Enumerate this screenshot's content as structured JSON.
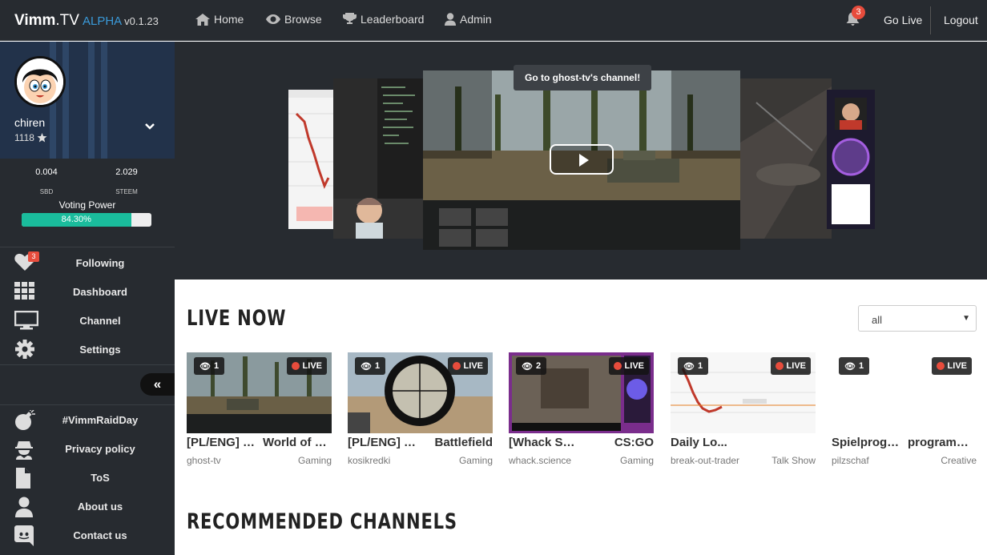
{
  "app": {
    "name": "Vimm",
    "suffix": ".TV",
    "alpha": "ALPHA",
    "version": "v0.1.23"
  },
  "nav": {
    "home": "Home",
    "browse": "Browse",
    "leaderboard": "Leaderboard",
    "admin": "Admin"
  },
  "header": {
    "notifications": "3",
    "go_live": "Go Live",
    "logout": "Logout"
  },
  "profile": {
    "username": "chiren",
    "reputation": "1118"
  },
  "wallet": {
    "sbd": "0.004",
    "sbd_label": "SBD",
    "steem": "2.029",
    "steem_label": "STEEM"
  },
  "voting": {
    "label": "Voting Power",
    "text": "84.30%",
    "fraction": 0.843
  },
  "menu": {
    "following": "Following",
    "following_badge": "3",
    "dashboard": "Dashboard",
    "channel": "Channel",
    "settings": "Settings",
    "raid": "#VimmRaidDay",
    "privacy": "Privacy policy",
    "tos": "ToS",
    "about": "About us",
    "contact": "Contact us"
  },
  "collapse_label": "«",
  "hero": {
    "tooltip": "Go to ghost-tv's channel!"
  },
  "live_now": {
    "title": "LIVE NOW",
    "filter": "all",
    "live_label": "LIVE",
    "streams": [
      {
        "viewers": "1",
        "title": "[PL/ENG] World of Tanks",
        "game": "World of Tanks",
        "user": "ghost-tv",
        "category": "Gaming"
      },
      {
        "viewers": "1",
        "title": "[PL/ENG] Battlefield",
        "game": "Battlefield",
        "user": "kosikredki",
        "category": "Gaming"
      },
      {
        "viewers": "2",
        "title": "[Whack Science]",
        "game": "CS:GO",
        "user": "whack.science",
        "category": "Gaming"
      },
      {
        "viewers": "1",
        "title": "Daily Lo...",
        "game": "",
        "user": "break-out-trader",
        "category": "Talk Show"
      },
      {
        "viewers": "1",
        "title": "Spielprogrammierung",
        "game": "programming",
        "user": "pilzschaf",
        "category": "Creative"
      }
    ]
  },
  "recommended": {
    "title": "RECOMMENDED CHANNELS"
  },
  "colors": {
    "accent": "#3a9ad9",
    "live_red": "#e74c3c",
    "vp_fill": "#1abc9c",
    "dark": "#272b30"
  }
}
